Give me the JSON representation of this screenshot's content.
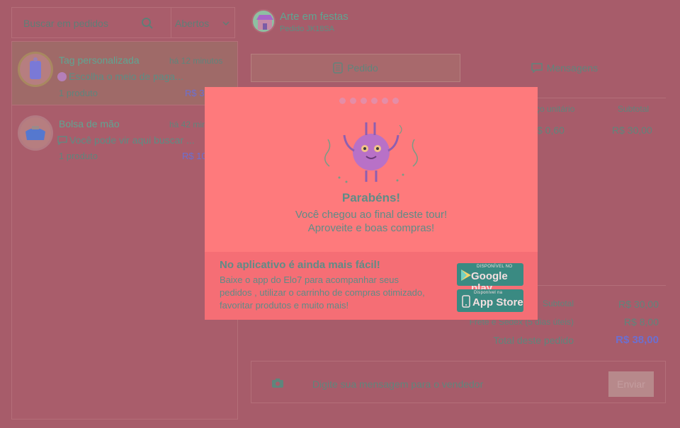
{
  "search": {
    "placeholder": "Buscar em pedidos",
    "filter": "Abertos"
  },
  "store": {
    "name": "Arte em festas",
    "order": "Pedido JK18SA"
  },
  "conversations": [
    {
      "title": "Tag personalizada",
      "time": "há 12 minutos",
      "message": "Escolha o meio de paga...",
      "count": "1 produto",
      "price": "R$ 3",
      "active": true
    },
    {
      "title": "Bolsa de mão",
      "time": "há 42 min",
      "message": "Você pode vir aqui buscar ...",
      "count": "1 produto",
      "price": "R$ 10",
      "active": false
    }
  ],
  "tabs": {
    "order": "Pedido",
    "messages": "Mensagens"
  },
  "table": {
    "headers": {
      "unit_price": "ço unitário",
      "subtotal": "Subtotal"
    },
    "row": {
      "unit_price": "$ 0,60",
      "subtotal": "R$ 30,00"
    }
  },
  "totals": {
    "subtotal_label": "Subtotal",
    "subtotal_value": "R$ 30,00",
    "shipping_label": "Frete e Sedex (5 dias úteis)",
    "shipping_value": "R$ 8,00",
    "total_label": "Total deste pedido",
    "total_value": "R$ 38,00"
  },
  "composer": {
    "placeholder": "Digite sua mensagem para o vendedor",
    "send": "Enviar"
  },
  "modal": {
    "step_dots": 6,
    "title": "Parabéns!",
    "line1": "Você chegou ao final deste tour!",
    "line2": "Aproveite e boas compras!",
    "app_title": "No aplicativo é ainda mais fácil!",
    "app_desc": "Baixe o app do Elo7 para acompanhar seus pedidos , utilizar o carrinho de compras otimizado, favoritar produtos e muito mais!",
    "google": {
      "small": "DISPONÍVEL NO",
      "big": "Google play"
    },
    "apple": {
      "small": "Disponível na",
      "big": "App Store"
    }
  },
  "colors": {
    "overlay": "#a75c6a",
    "modal": "#fe7a7c",
    "accent": "#5fa592",
    "button": "#3a8a82"
  }
}
